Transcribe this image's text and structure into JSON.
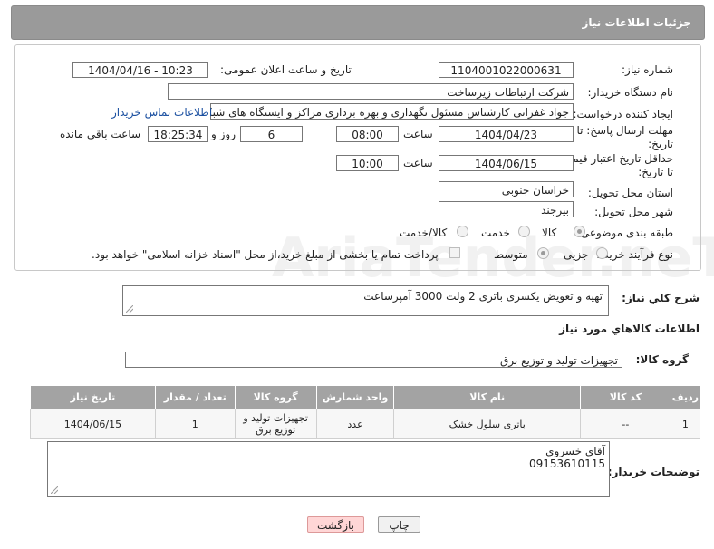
{
  "header": {
    "title": "جزئیات اطلاعات نیاز"
  },
  "watermark": "AriaTender.neT",
  "form": {
    "need_number_label": "شماره نیاز:",
    "need_number": "1104001022000631",
    "announce_label": "تاریخ و ساعت اعلان عمومی:",
    "announce_value": "1404/04/16 - 10:23",
    "buyer_org_label": "نام دستگاه خریدار:",
    "buyer_org": "شرکت ارتباطات زیرساخت",
    "creator_label": "ایجاد کننده درخواست:",
    "creator": "جواد غفرانی کارشناس مسئول نگهداری و بهره برداری مراکز و ایستگاه های شبکه",
    "contact_link": "اطلاعات تماس خریدار",
    "deadline_label_1": "مهلت ارسال پاسخ: تا",
    "deadline_label_2": "تاریخ:",
    "deadline_date": "1404/04/23",
    "time_label": "ساعت",
    "deadline_time": "08:00",
    "days_value": "6",
    "days_label": "روز و",
    "remaining_time": "18:25:34",
    "remaining_label": "ساعت باقی مانده",
    "validity_label_1": "حداقل تاریخ اعتبار قیمت:",
    "validity_label_2": "تا تاریخ:",
    "validity_date": "1404/06/15",
    "validity_time": "10:00",
    "province_label": "استان محل تحویل:",
    "province": "خراسان جنوبی",
    "city_label": "شهر محل تحویل:",
    "city": "بیرجند",
    "category_label": "طبقه بندی موضوعی:",
    "category_options": [
      "کالا",
      "خدمت",
      "کالا/خدمت"
    ],
    "process_label": "نوع فرآیند خرید :",
    "process_options": [
      "جزیی",
      "متوسط"
    ],
    "payment_note": "پرداخت تمام یا بخشی از مبلغ خرید،از محل \"اسناد خزانه اسلامی\" خواهد بود."
  },
  "description": {
    "label": "شرح کلي نياز:",
    "value": "تهیه و تعویض یکسری باتری 2 ولت 3000 آمپرساعت"
  },
  "goods_info": {
    "title": "اطلاعات کالاهاي مورد نياز",
    "group_label": "گروه کالا:",
    "group_value": "تجهیزات تولید و توزیع برق"
  },
  "table": {
    "headers": [
      "ردیف",
      "کد کالا",
      "نام کالا",
      "واحد شمارش",
      "گروه کالا",
      "تعداد / مقدار",
      "تاریخ نیاز"
    ],
    "rows": [
      [
        "1",
        "--",
        "باتری سلول خشک",
        "عدد",
        "تجهیزات تولید و توزیع برق",
        "1",
        "1404/06/15"
      ]
    ]
  },
  "buyer_notes": {
    "label": "توضیحات خریدار:",
    "line1": "آقای خسروی",
    "line2": "09153610115"
  },
  "buttons": {
    "print": "چاپ",
    "back": "بازگشت"
  }
}
